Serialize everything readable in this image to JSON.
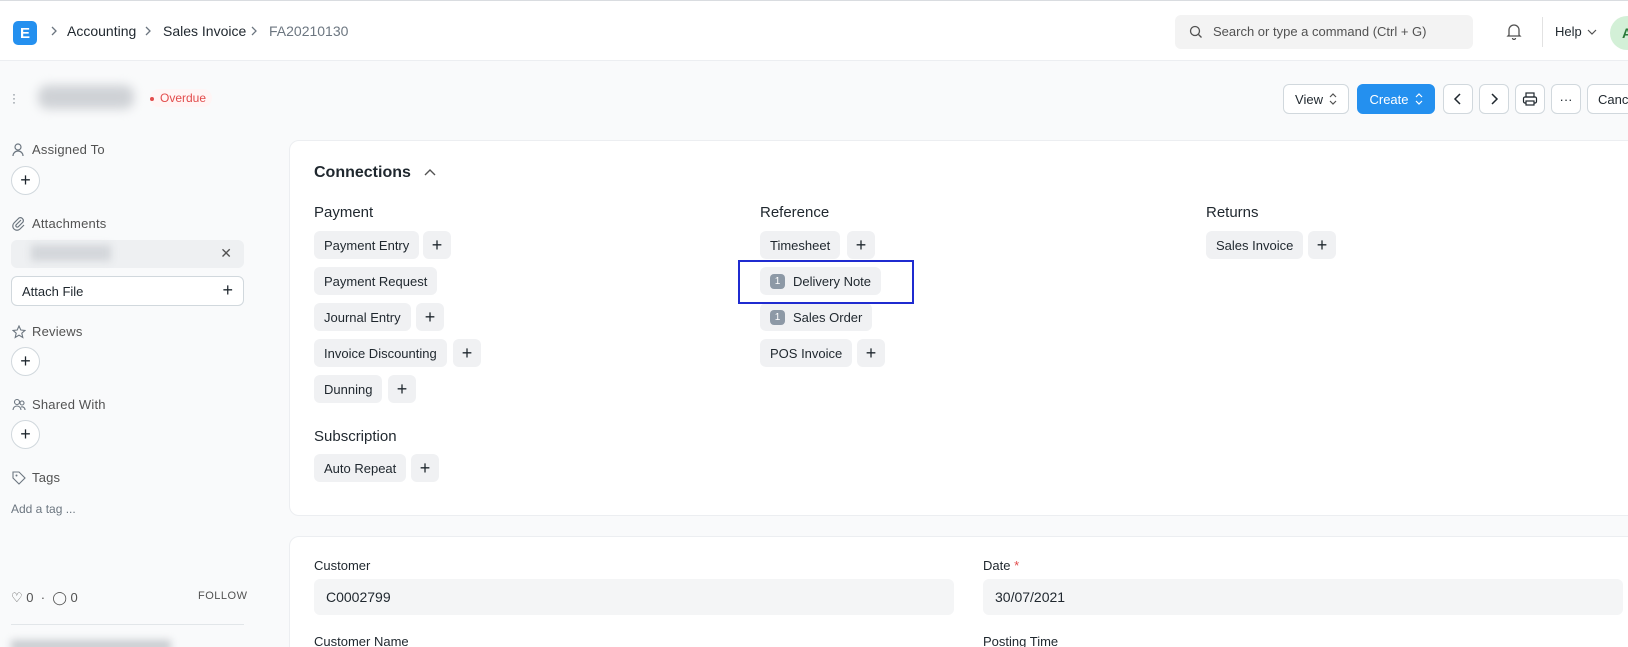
{
  "navbar": {
    "breadcrumbs": [
      "Accounting",
      "Sales Invoice",
      "FA20210130"
    ],
    "search_placeholder": "Search or type a command (Ctrl + G)",
    "help_label": "Help",
    "avatar_letter": "A",
    "logo_letter": "E"
  },
  "page_head": {
    "status": "Overdue",
    "view_label": "View",
    "create_label": "Create",
    "more_label": "···",
    "cancel_label": "Cancel"
  },
  "sidebar": {
    "assigned_to": "Assigned To",
    "attachments": "Attachments",
    "attach_file": "Attach File",
    "reviews": "Reviews",
    "shared_with": "Shared With",
    "tags": "Tags",
    "add_tag": "Add a tag ...",
    "likes_count": "0",
    "comments_count": "0",
    "follow": "FOLLOW"
  },
  "connections": {
    "title": "Connections",
    "groups": {
      "payment": {
        "title": "Payment",
        "items": [
          "Payment Entry",
          "Payment Request",
          "Journal Entry",
          "Invoice Discounting",
          "Dunning"
        ]
      },
      "reference": {
        "title": "Reference",
        "items": [
          "Timesheet",
          "Delivery Note",
          "Sales Order",
          "POS Invoice"
        ],
        "counts": {
          "delivery_note": "1",
          "sales_order": "1"
        }
      },
      "returns": {
        "title": "Returns",
        "items": [
          "Sales Invoice"
        ]
      },
      "subscription": {
        "title": "Subscription",
        "items": [
          "Auto Repeat"
        ]
      }
    }
  },
  "form": {
    "customer_label": "Customer",
    "customer_value": "C0002799",
    "date_label": "Date",
    "date_required": "*",
    "date_value": "30/07/2021",
    "customer_name_label": "Customer Name",
    "posting_time_label": "Posting Time"
  },
  "colors": {
    "accent": "#2490ef",
    "status_red": "#e24c4c",
    "highlight": "#1f2bd0"
  }
}
